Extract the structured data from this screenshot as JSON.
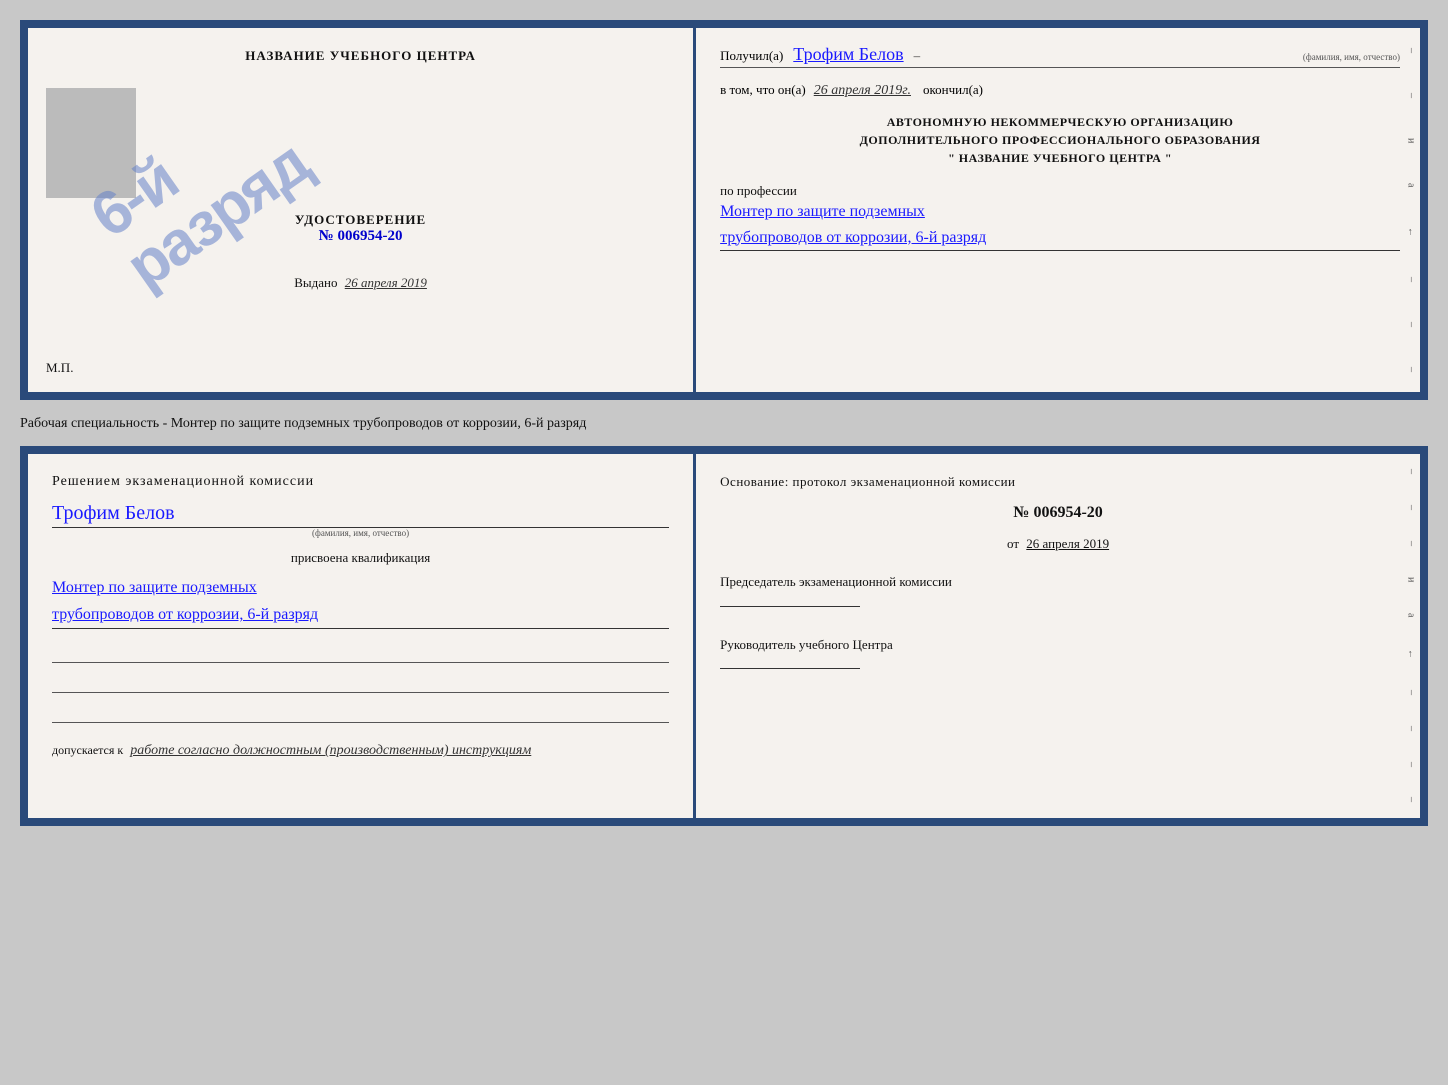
{
  "page": {
    "background": "#c8c8c8"
  },
  "top_cert": {
    "left": {
      "title": "НАЗВАНИЕ УЧЕБНОГО ЦЕНТРА",
      "photo_alt": "фото",
      "stamp_text": "6-й разряд",
      "udost_label": "УДОСТОВЕРЕНИЕ",
      "udost_number": "№ 006954-20",
      "vydano_label": "Выдано",
      "vydano_date": "26 апреля 2019",
      "mp_label": "М.П."
    },
    "right": {
      "poluchil_label": "Получил(а)",
      "poluchil_name": "Трофим Белов",
      "fio_label": "(фамилия, имя, отчество)",
      "vtom_label": "в том, что он(а)",
      "vtom_date": "26 апреля 2019г.",
      "okonchil_label": "окончил(а)",
      "org_line1": "АВТОНОМНУЮ НЕКОММЕРЧЕСКУЮ ОРГАНИЗАЦИЮ",
      "org_line2": "ДОПОЛНИТЕЛЬНОГО ПРОФЕССИОНАЛЬНОГО ОБРАЗОВАНИЯ",
      "org_name": "\"   НАЗВАНИЕ УЧЕБНОГО ЦЕНТРА   \"",
      "po_professii_label": "по профессии",
      "profession_line1": "Монтер по защите подземных",
      "profession_line2": "трубопроводов от коррозии, 6-й разряд",
      "edge_marks": [
        "–",
        "–",
        "и",
        "а",
        "←",
        "–",
        "–",
        "–"
      ]
    }
  },
  "specialty_line": {
    "text": "Рабочая специальность - Монтер по защите подземных трубопроводов от коррозии, 6-й разряд"
  },
  "bottom_cert": {
    "left": {
      "resheniem_text": "Решением экзаменационной комиссии",
      "name": "Трофим Белов",
      "fio_label": "(фамилия, имя, отчество)",
      "prisvoyena_label": "присвоена квалификация",
      "profession_line1": "Монтер по защите подземных",
      "profession_line2": "трубопроводов от коррозии, 6-й разряд",
      "blank_lines": [
        "",
        "",
        ""
      ],
      "dopuskaetsya_label": "допускается к",
      "dopuskaetsya_text": "работе согласно должностным (производственным) инструкциям"
    },
    "right": {
      "osnovanie_label": "Основание: протокол экзаменационной комиссии",
      "protocol_number": "№ 006954-20",
      "ot_label": "от",
      "ot_date": "26 апреля 2019",
      "predsedatel_label": "Председатель экзаменационной комиссии",
      "rukovoditel_label": "Руководитель учебного Центра",
      "edge_marks": [
        "–",
        "–",
        "–",
        "и",
        "а",
        "←",
        "–",
        "–",
        "–",
        "–"
      ]
    }
  }
}
